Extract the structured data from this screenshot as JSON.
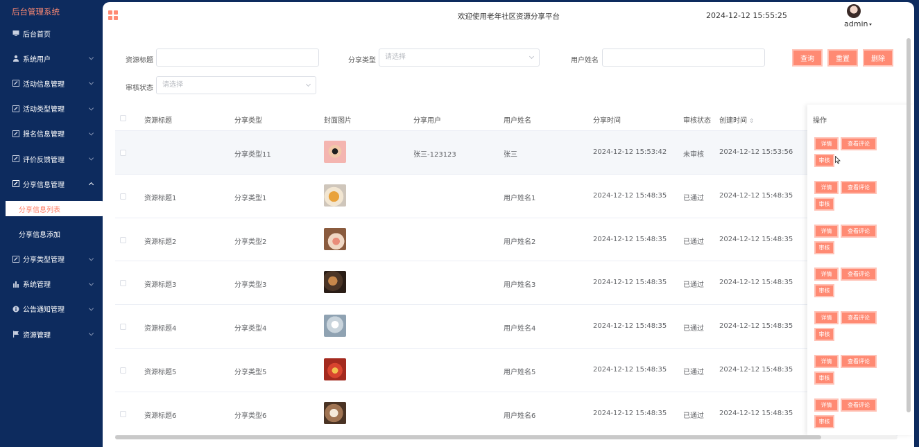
{
  "app": {
    "title": "后台管理系统"
  },
  "header": {
    "welcome": "欢迎使用老年社区资源分享平台",
    "datetime": "2024-12-12 15:55:25",
    "user": "admin"
  },
  "sidebar": {
    "items": [
      {
        "label": "后台首页",
        "icon": "monitor-icon"
      },
      {
        "label": "系统用户",
        "icon": "user-icon"
      },
      {
        "label": "活动信息管理",
        "icon": "edit-icon"
      },
      {
        "label": "活动类型管理",
        "icon": "edit-icon"
      },
      {
        "label": "报名信息管理",
        "icon": "edit-icon"
      },
      {
        "label": "评价反馈管理",
        "icon": "edit-icon"
      },
      {
        "label": "分享信息管理",
        "icon": "edit-icon"
      },
      {
        "label": "分享类型管理",
        "icon": "edit-icon"
      },
      {
        "label": "系统管理",
        "icon": "bar-chart-icon"
      },
      {
        "label": "公告通知管理",
        "icon": "info-icon"
      },
      {
        "label": "资源管理",
        "icon": "flag-icon"
      }
    ],
    "subitems": [
      {
        "label": "分享信息列表"
      },
      {
        "label": "分享信息添加"
      }
    ]
  },
  "search": {
    "title_label": "资源标题",
    "type_label": "分享类型",
    "type_placeholder": "请选择",
    "name_label": "用户姓名",
    "status_label": "审核状态",
    "status_placeholder": "请选择",
    "query_btn": "查询",
    "reset_btn": "重置",
    "delete_btn": "删除"
  },
  "table": {
    "headers": [
      "资源标题",
      "分享类型",
      "封面图片",
      "分享用户",
      "用户姓名",
      "分享时间",
      "审核状态",
      "创建时间",
      "操作"
    ],
    "actions": {
      "detail": "详情",
      "comments": "查看评论",
      "review": "审核"
    },
    "rows": [
      {
        "title": "",
        "type": "分享类型11",
        "user": "张三-123123",
        "name": "张三",
        "share_time": "2024-12-12 15:53:42",
        "status": "未审核",
        "created": "2024-12-12 15:53:56"
      },
      {
        "title": "资源标题1",
        "type": "分享类型1",
        "user": "",
        "name": "用户姓名1",
        "share_time": "2024-12-12 15:48:35",
        "status": "已通过",
        "created": "2024-12-12 15:48:35"
      },
      {
        "title": "资源标题2",
        "type": "分享类型2",
        "user": "",
        "name": "用户姓名2",
        "share_time": "2024-12-12 15:48:35",
        "status": "已通过",
        "created": "2024-12-12 15:48:35"
      },
      {
        "title": "资源标题3",
        "type": "分享类型3",
        "user": "",
        "name": "用户姓名3",
        "share_time": "2024-12-12 15:48:35",
        "status": "已通过",
        "created": "2024-12-12 15:48:35"
      },
      {
        "title": "资源标题4",
        "type": "分享类型4",
        "user": "",
        "name": "用户姓名4",
        "share_time": "2024-12-12 15:48:35",
        "status": "已通过",
        "created": "2024-12-12 15:48:35"
      },
      {
        "title": "资源标题5",
        "type": "分享类型5",
        "user": "",
        "name": "用户姓名5",
        "share_time": "2024-12-12 15:48:35",
        "status": "已通过",
        "created": "2024-12-12 15:48:35"
      },
      {
        "title": "资源标题6",
        "type": "分享类型6",
        "user": "",
        "name": "用户姓名6",
        "share_time": "2024-12-12 15:48:35",
        "status": "已通过",
        "created": "2024-12-12 15:48:35"
      }
    ]
  },
  "colors": {
    "sidebar_bg": "#0d2b5e",
    "accent": "#ff8a73",
    "accent_border": "#ffc2b6"
  }
}
